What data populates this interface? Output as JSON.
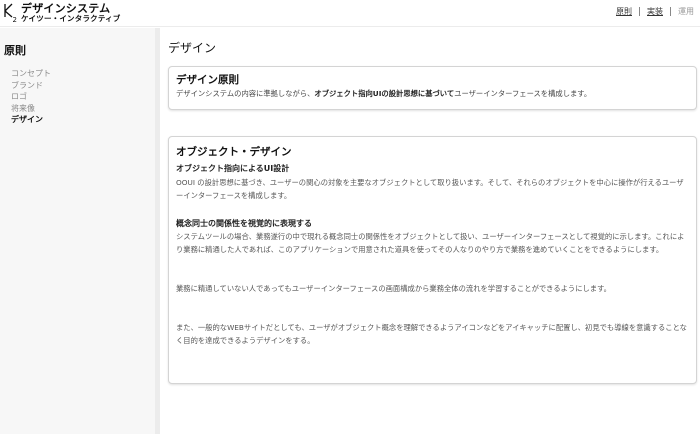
{
  "header": {
    "brand_title": "デザインシステム",
    "brand_subtitle": "ケイツー・インタラクティブ",
    "nav": [
      {
        "label": "原則"
      },
      {
        "label": "実装"
      },
      {
        "label": "運用"
      }
    ]
  },
  "sidebar": {
    "title": "原則",
    "items": [
      {
        "label": "コンセプト"
      },
      {
        "label": "ブランド"
      },
      {
        "label": "ロゴ"
      },
      {
        "label": "将来像"
      },
      {
        "label": "デザイン"
      }
    ]
  },
  "main": {
    "title": "デザイン",
    "card1": {
      "title": "デザイン原則",
      "text_before": "デザインシステムの内容に準拠しながら、",
      "text_bold": "オブジェクト指向UIの設計思想に基づいて",
      "text_after": "ユーザーインターフェースを構成します。"
    },
    "card2": {
      "title": "オブジェクト・デザイン",
      "section1_heading": "オブジェクト指向によるUI設計",
      "section1_text": "OOUI の設計思想に基づき、ユーザーの関心の対象を主要なオブジェクトとして取り扱います。そして、それらのオブジェクトを中心に操作が行えるユーザーインターフェースを構成します。",
      "section2_heading": "概念同士の関係性を視覚的に表現する",
      "section2_text": "システムツールの場合、業務遂行の中で現れる概念同士の関係性をオブジェクトとして扱い、ユーザーインターフェースとして視覚的に示します。これにより業務に精通した人であれば、このアプリケーションで用意された道具を使ってその人なりのやり方で業務を進めていくことをできるようにします。",
      "para3": "業務に精通していない人であってもユーザーインターフェースの画面構成から業務全体の流れを学習することができるようにします。",
      "para4": "また、一般的なWEBサイトだとしても、ユーザがオブジェクト概念を理解できるようアイコンなどをアイキャッチに配置し、初見でも導線を意識することなく目的を達成できるようデザインをする。"
    }
  }
}
